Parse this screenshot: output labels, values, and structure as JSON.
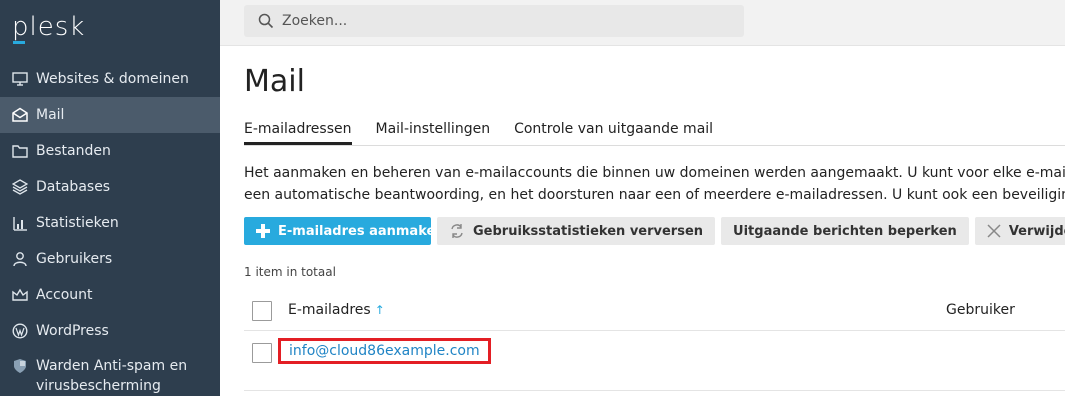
{
  "sidebar": {
    "logo": "plesk",
    "items": [
      {
        "label": "Websites & domeinen",
        "icon": "monitor-icon"
      },
      {
        "label": "Mail",
        "icon": "mail-icon",
        "active": true
      },
      {
        "label": "Bestanden",
        "icon": "folder-icon"
      },
      {
        "label": "Databases",
        "icon": "layers-icon"
      },
      {
        "label": "Statistieken",
        "icon": "bar-chart-icon"
      },
      {
        "label": "Gebruikers",
        "icon": "user-icon"
      },
      {
        "label": "Account",
        "icon": "crown-icon"
      },
      {
        "label": "WordPress",
        "icon": "wordpress-icon"
      },
      {
        "label": "Warden Anti-spam en virusbescherming",
        "label_line1": "Warden Anti-spam en",
        "label_line2": "virusbescherming",
        "icon": "shield-icon"
      }
    ]
  },
  "search": {
    "placeholder": "Zoeken..."
  },
  "main": {
    "title": "Mail",
    "tabs": [
      {
        "label": "E-mailadressen",
        "active": true
      },
      {
        "label": "Mail-instellingen"
      },
      {
        "label": "Controle van uitgaande mail"
      }
    ],
    "description_line1": "Het aanmaken en beheren van e-mailaccounts die binnen uw domeinen werden aangemaakt. U kunt voor elke e-mailaccount",
    "description_line2": "een automatische beantwoording, en het doorsturen naar een of meerdere e-mailadressen. U kunt ook een beveiliging tegen s",
    "toolbar": {
      "create": "E-mailadres aanmaken",
      "refresh": "Gebruiksstatistieken verversen",
      "limit": "Uitgaande berichten beperken",
      "delete": "Verwijderen"
    },
    "count": "1 item in totaal",
    "table": {
      "col_email": "E-mailadres",
      "col_user": "Gebruiker",
      "rows": [
        {
          "email": "info@cloud86example.com"
        }
      ]
    }
  },
  "colors": {
    "sidebar_bg": "#2e3e4e",
    "sidebar_active": "#4b5b6b",
    "accent": "#28aade",
    "link": "#1f84c5",
    "highlight": "#e31e24"
  }
}
